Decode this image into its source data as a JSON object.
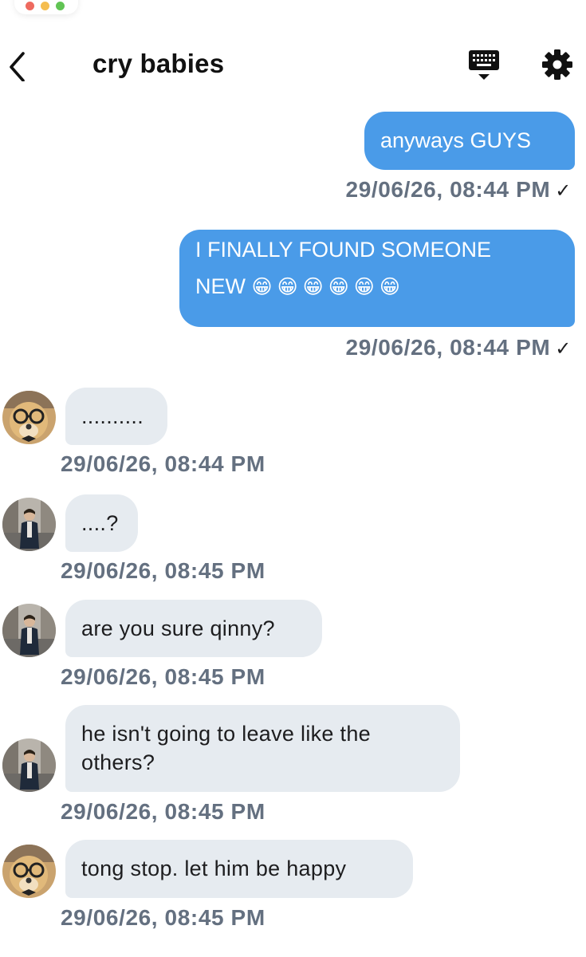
{
  "header": {
    "title": "cry babies"
  },
  "messages": [
    {
      "text": "anyways GUYS",
      "time": "29/06/26, 08:44 PM",
      "check": "✓"
    },
    {
      "text_line1": "I FINALLY FOUND SOMEONE",
      "text_line2": "NEW",
      "emoji": "😁😁😁😁😁😁",
      "time": "29/06/26, 08:44 PM",
      "check": "✓"
    },
    {
      "text": "..........",
      "time": "29/06/26, 08:44 PM"
    },
    {
      "text": "....?",
      "time": "29/06/26, 08:45 PM"
    },
    {
      "text": "are you sure qinny?",
      "time": "29/06/26, 08:45 PM"
    },
    {
      "text_line1": "he isn't going to leave like the",
      "text_line2": "others?",
      "time": "29/06/26, 08:45 PM"
    },
    {
      "text": "tong stop. let him be happy",
      "time": "29/06/26, 08:45 PM"
    }
  ],
  "colors": {
    "outgoing_bubble": "#4a9be8",
    "incoming_bubble": "#e6ebf0",
    "timestamp": "#647080"
  },
  "icons": {
    "back": "chevron-left-icon",
    "keyboard": "keyboard-icon",
    "settings": "gear-icon"
  }
}
